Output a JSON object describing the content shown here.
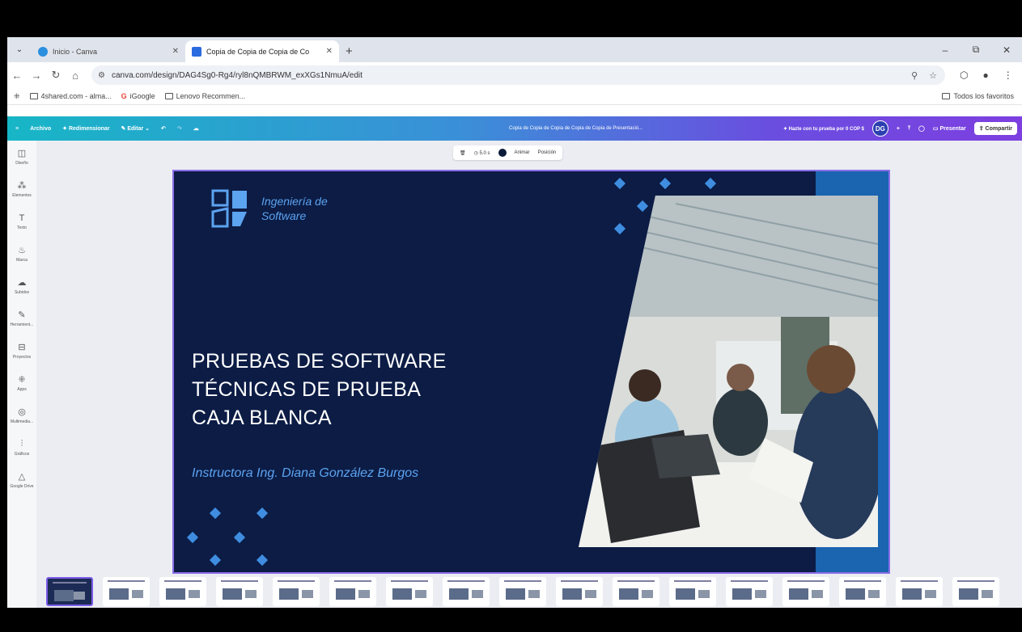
{
  "browser": {
    "tabs": [
      {
        "label": "Inicio - Canva",
        "active": false
      },
      {
        "label": "Copia de Copia de Copia de Co",
        "active": true
      }
    ],
    "new_tab": "+",
    "url": "canva.com/design/DAG4Sg0-Rg4/ryl8nQMBRWM_exXGs1NmuA/edit",
    "bookmarks": [
      {
        "label": "4shared.com - alma..."
      },
      {
        "label": "iGoogle"
      },
      {
        "label": "Lenovo Recommen..."
      }
    ],
    "all_bookmarks": "Todos los favoritos"
  },
  "toolbar": {
    "archivo": "Archivo",
    "redimensionar": "Redimensionar",
    "editar": "Editar",
    "doc_title": "Copia de Copia de Copia de Copia de Copia de Presentació...",
    "pro_offer": "Hazte con tu prueba por 0 COP $",
    "avatar": "DG",
    "presentar": "Presentar",
    "compartir": "Compartir"
  },
  "sidebar": {
    "items": [
      {
        "label": "Diseño",
        "icon": "design-icon",
        "glyph": "◫"
      },
      {
        "label": "Elementos",
        "icon": "elements-icon",
        "glyph": "⁂"
      },
      {
        "label": "Texto",
        "icon": "text-icon",
        "glyph": "T"
      },
      {
        "label": "Marca",
        "icon": "brand-icon",
        "glyph": "♨"
      },
      {
        "label": "Subidos",
        "icon": "upload-icon",
        "glyph": "☁"
      },
      {
        "label": "Herramient...",
        "icon": "tools-icon",
        "glyph": "✎"
      },
      {
        "label": "Proyectos",
        "icon": "folder-icon",
        "glyph": "⊟"
      },
      {
        "label": "Apps",
        "icon": "apps-icon",
        "glyph": "⁜"
      },
      {
        "label": "Multimedia...",
        "icon": "media-icon",
        "glyph": "◎"
      },
      {
        "label": "Gráficos",
        "icon": "charts-icon",
        "glyph": "⫶"
      },
      {
        "label": "Google Drive",
        "icon": "drive-icon",
        "glyph": "△"
      }
    ]
  },
  "element_bar": {
    "duration": "5.0 s",
    "animar": "Animar",
    "posicion": "Posición"
  },
  "slide": {
    "brand_line1": "Ingeniería de",
    "brand_line2": "Software",
    "title_line1": "PRUEBAS DE SOFTWARE",
    "title_line2": "TÉCNICAS DE PRUEBA",
    "title_line3": "CAJA BLANCA",
    "instructor": "Instructora Ing. Diana González Burgos",
    "colors": {
      "background": "#0c1c45",
      "accent": "#5ca3f0",
      "band": "#1a64b0"
    }
  },
  "thumbnails_count": 17
}
